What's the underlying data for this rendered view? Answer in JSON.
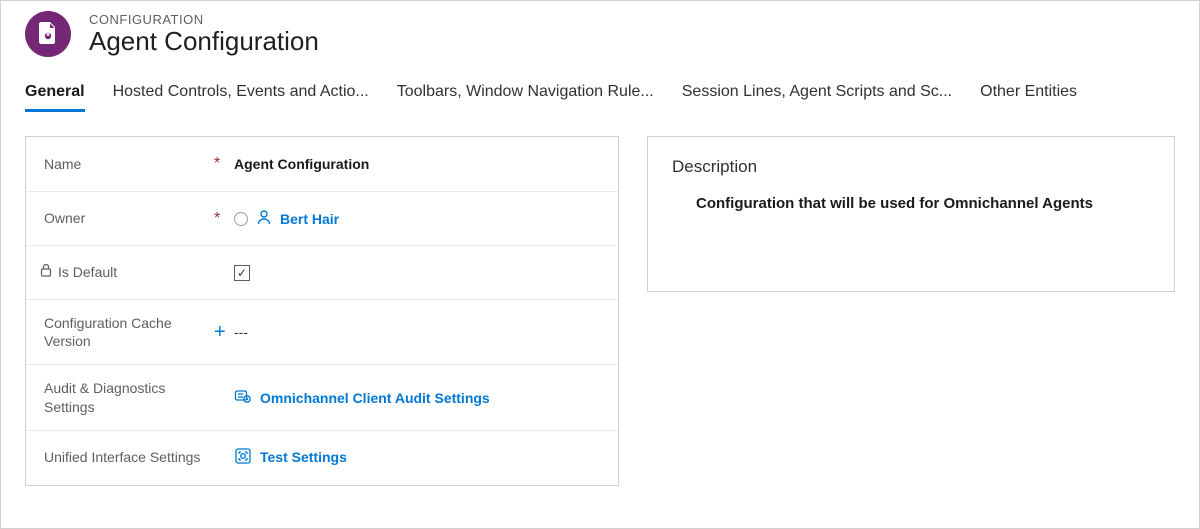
{
  "breadcrumb": "CONFIGURATION",
  "title": "Agent Configuration",
  "tabs": [
    {
      "label": "General",
      "active": true
    },
    {
      "label": "Hosted Controls, Events and Actio...",
      "active": false
    },
    {
      "label": "Toolbars, Window Navigation Rule...",
      "active": false
    },
    {
      "label": "Session Lines, Agent Scripts and Sc...",
      "active": false
    },
    {
      "label": "Other Entities",
      "active": false
    }
  ],
  "form": {
    "name": {
      "label": "Name",
      "required": "*",
      "value": "Agent Configuration"
    },
    "owner": {
      "label": "Owner",
      "required": "*",
      "value": "Bert Hair"
    },
    "is_default": {
      "label": "Is Default",
      "checked": true
    },
    "cache": {
      "label": "Configuration Cache Version",
      "recommended": "+",
      "value": "---"
    },
    "audit": {
      "label": "Audit & Diagnostics Settings",
      "value": "Omnichannel Client Audit Settings"
    },
    "ui": {
      "label": "Unified Interface Settings",
      "value": "Test Settings"
    },
    "description": {
      "label": "Description",
      "value": "Configuration that will be used for Omnichannel Agents"
    }
  }
}
